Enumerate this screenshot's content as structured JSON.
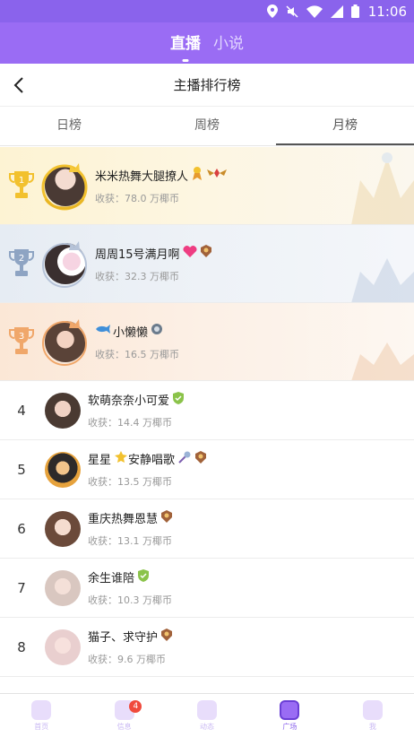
{
  "status_bar": {
    "time": "11:06"
  },
  "top_tabs": [
    {
      "label": "直播",
      "active": true
    },
    {
      "label": "小说",
      "active": false
    }
  ],
  "header": {
    "title": "主播排行榜"
  },
  "period_tabs": [
    {
      "label": "日榜",
      "active": false
    },
    {
      "label": "周榜",
      "active": false
    },
    {
      "label": "月榜",
      "active": true
    }
  ],
  "ranking": [
    {
      "rank": "1",
      "name": "米米热舞大腿撩人",
      "income": "收获：78.0 万椰币",
      "badge_icon": "ribbon-icon"
    },
    {
      "rank": "2",
      "name": "周周15号满月啊",
      "income": "收获：32.3 万椰币",
      "badge_icon": "heart-icon"
    },
    {
      "rank": "3",
      "name": "小懒懒",
      "income": "收获：16.5 万椰币",
      "badge_icon": "whale-icon"
    },
    {
      "rank": "4",
      "name": "软萌奈奈小可爱",
      "income": "收获：14.4 万椰币"
    },
    {
      "rank": "5",
      "name": "星星",
      "name_suffix": "安静唱歌",
      "income": "收获：13.5 万椰币"
    },
    {
      "rank": "6",
      "name": "重庆热舞恩慧",
      "income": "收获：13.1 万椰币"
    },
    {
      "rank": "7",
      "name": "余生谁陪",
      "income": "收获：10.3 万椰币"
    },
    {
      "rank": "8",
      "name": "猫子、求守护",
      "income": "收获：9.6 万椰币"
    }
  ],
  "bottom_nav": [
    {
      "label": "首页",
      "icon": "home-icon"
    },
    {
      "label": "信息",
      "icon": "message-icon",
      "badge": "4"
    },
    {
      "label": "动态",
      "icon": "feed-icon"
    },
    {
      "label": "广场",
      "icon": "square-icon",
      "active": true
    },
    {
      "label": "我",
      "icon": "cat-icon"
    }
  ],
  "colors": {
    "brand": "#9a6cf4",
    "status_bar": "#8a63ec",
    "gold": "#f2c12e",
    "silver": "#8ea4c3",
    "bronze": "#f0a76a",
    "badge_red": "#f04a3c"
  }
}
